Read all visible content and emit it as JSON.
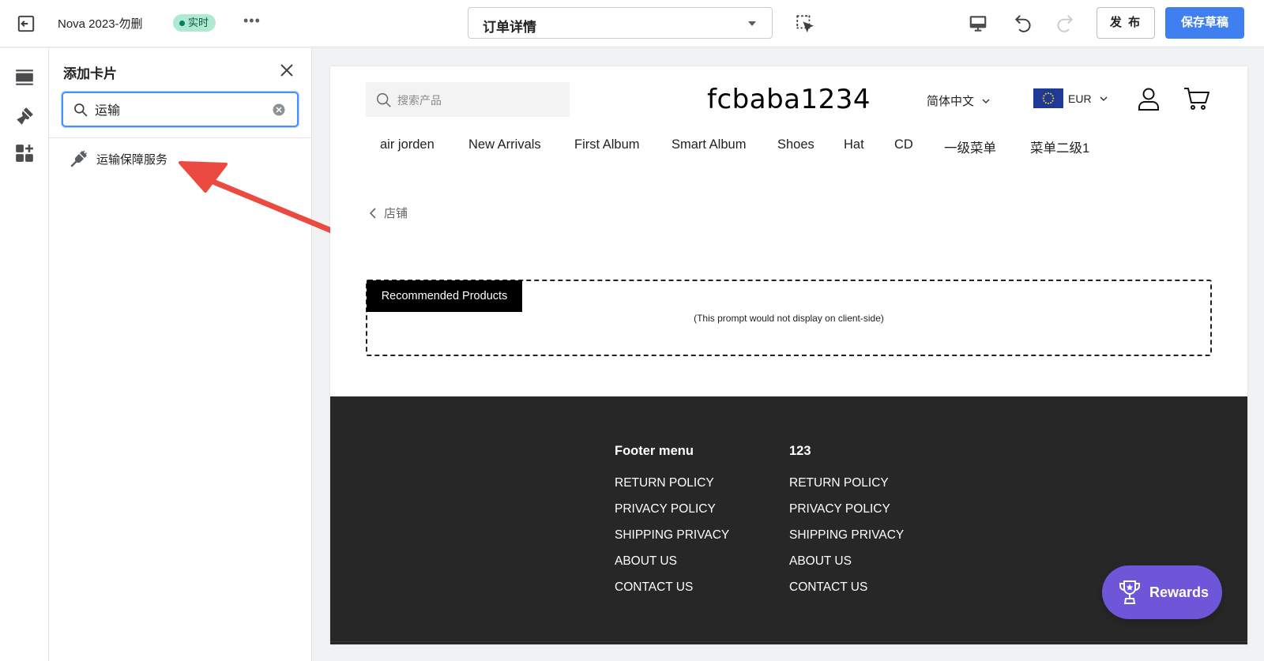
{
  "topbar": {
    "store_name": "Nova 2023-勿删",
    "live_badge": "实时",
    "more": "•••",
    "page_select": "订单详情",
    "publish_label": "发 布",
    "save_label": "保存草稿"
  },
  "rail": {
    "icons": [
      "sections-icon",
      "theme-settings-brush-icon",
      "apps-add-icon"
    ]
  },
  "panel": {
    "title": "添加卡片",
    "search_value": "运输",
    "results": [
      {
        "label": "运输保障服务",
        "icon": "plug-icon"
      }
    ]
  },
  "storefront": {
    "search_placeholder": "搜索产品",
    "logo": "fcbaba1234",
    "language": "简体中文",
    "currency": "EUR",
    "nav": [
      "air jorden",
      "New Arrivals",
      "First Album",
      "Smart Album",
      "Shoes",
      "Hat",
      "CD",
      "一级菜单",
      "菜单二级1"
    ],
    "back_label": "店铺",
    "recommended_tab": "Recommended Products",
    "recommended_note": "(This prompt would not display on client-side)",
    "footer": {
      "columns": [
        {
          "title": "Footer menu",
          "links": [
            "RETURN POLICY",
            "PRIVACY POLICY",
            "SHIPPING PRIVACY",
            "ABOUT US",
            "CONTACT US"
          ]
        },
        {
          "title": "123",
          "links": [
            "RETURN POLICY",
            "PRIVACY POLICY",
            "SHIPPING PRIVACY",
            "ABOUT US",
            "CONTACT US"
          ]
        }
      ]
    }
  },
  "rewards": {
    "label": "Rewards"
  },
  "colors": {
    "primary": "#3f7ff0",
    "live_badge_bg": "#aee9d1",
    "annotation_arrow": "#ea4a3f",
    "footer_bg": "#272727",
    "rewards_bg": "#6d56d8"
  }
}
